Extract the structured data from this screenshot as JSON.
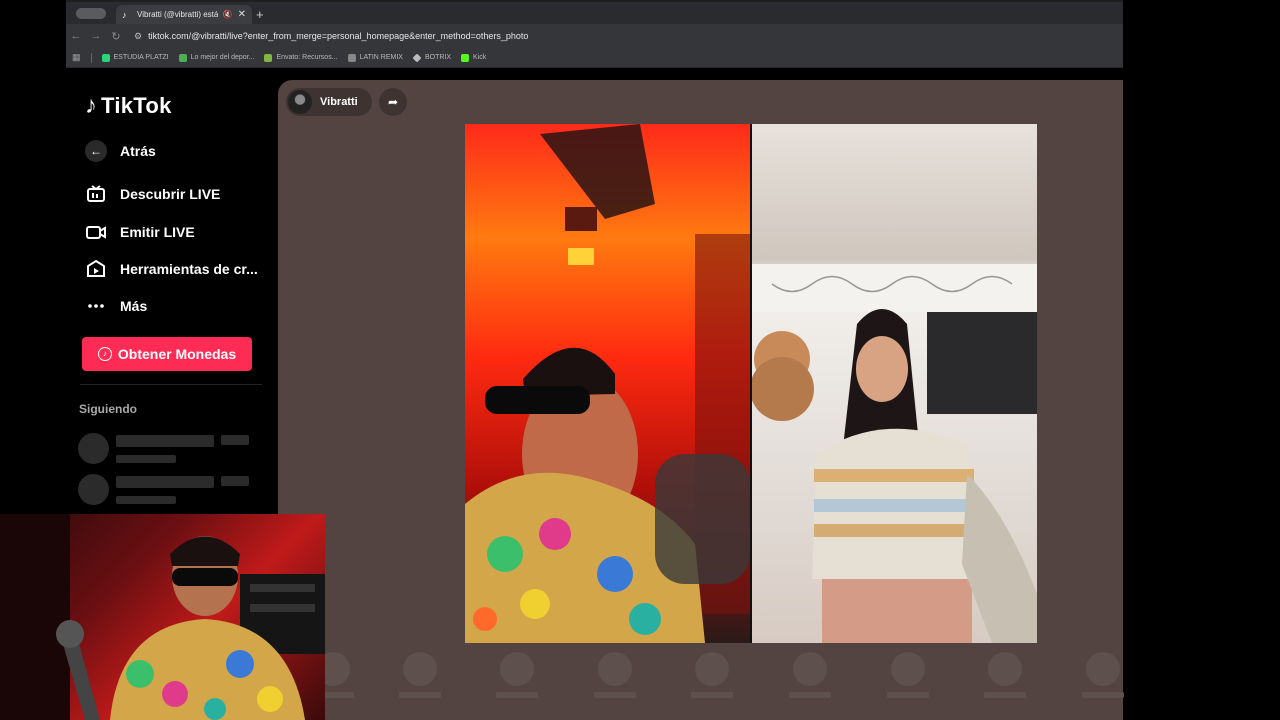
{
  "browser": {
    "tab_title": "Vibratti (@vibratti) está L",
    "tab_close": "✕",
    "new_tab": "+",
    "url": "tiktok.com/@vibratti/live?enter_from_merge=personal_homepage&enter_method=others_photo",
    "bookmarks": [
      {
        "label": "ESTUDIA PLATZI",
        "color": "#2bd576"
      },
      {
        "label": "Lo mejor del depor...",
        "color": "#4caf50"
      },
      {
        "label": "Envato: Recursos...",
        "color": "#82b541"
      },
      {
        "label": "LATIN REMIX",
        "color": "#888888"
      },
      {
        "label": "BOTRIX",
        "color": "#bbbbbb"
      },
      {
        "label": "Kick",
        "color": "#53fc18"
      }
    ]
  },
  "sidebar": {
    "logo": "TikTok",
    "back": "Atrás",
    "nav": [
      {
        "label": "Descubrir LIVE",
        "icon": "live-tv-icon"
      },
      {
        "label": "Emitir LIVE",
        "icon": "video-camera-icon"
      },
      {
        "label": "Herramientas de cr...",
        "icon": "creator-tools-icon"
      },
      {
        "label": "Más",
        "icon": "more-dots-icon"
      }
    ],
    "coins_button": "Obtener Monedas",
    "following_heading": "Siguiendo"
  },
  "live": {
    "host_name": "Vibratti"
  },
  "colors": {
    "accent": "#fe2c55",
    "live_bg": "#534441"
  }
}
